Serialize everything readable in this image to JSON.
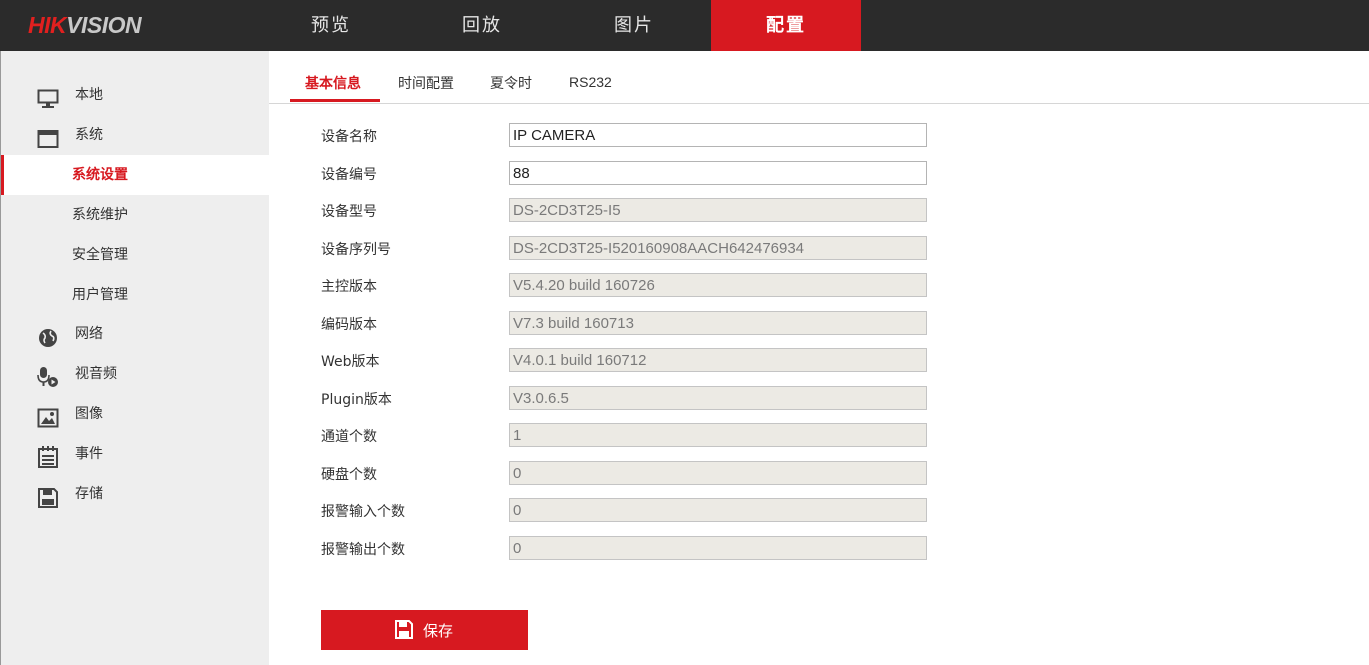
{
  "brand": {
    "logo_red": "HIK",
    "logo_gray": "VISION"
  },
  "nav": {
    "tabs": [
      "预览",
      "回放",
      "图片",
      "配置"
    ],
    "active": "配置"
  },
  "sidebar": {
    "items": [
      {
        "label": "本地",
        "icon": "monitor-icon"
      },
      {
        "label": "系统",
        "icon": "window-icon"
      },
      {
        "label": "系统设置",
        "sub": true,
        "active": true
      },
      {
        "label": "系统维护",
        "sub": true
      },
      {
        "label": "安全管理",
        "sub": true
      },
      {
        "label": "用户管理",
        "sub": true
      },
      {
        "label": "网络",
        "icon": "globe-icon"
      },
      {
        "label": "视音频",
        "icon": "microphone-icon"
      },
      {
        "label": "图像",
        "icon": "image-icon"
      },
      {
        "label": "事件",
        "icon": "list-icon"
      },
      {
        "label": "存储",
        "icon": "floppy-icon"
      }
    ]
  },
  "subtabs": [
    "基本信息",
    "时间配置",
    "夏令时",
    "RS232"
  ],
  "form": {
    "rows": [
      {
        "label": "设备名称",
        "value": "IP CAMERA",
        "editable": true
      },
      {
        "label": "设备编号",
        "value": "88",
        "editable": true
      },
      {
        "label": "设备型号",
        "value": "DS-2CD3T25-I5",
        "editable": false
      },
      {
        "label": "设备序列号",
        "value": "DS-2CD3T25-I520160908AACH642476934",
        "editable": false
      },
      {
        "label": "主控版本",
        "value": "V5.4.20 build 160726",
        "editable": false
      },
      {
        "label": "编码版本",
        "value": "V7.3 build 160713",
        "editable": false
      },
      {
        "label": "Web版本",
        "value": "V4.0.1 build 160712",
        "editable": false
      },
      {
        "label": "Plugin版本",
        "value": "V3.0.6.5",
        "editable": false
      },
      {
        "label": "通道个数",
        "value": "1",
        "editable": false
      },
      {
        "label": "硬盘个数",
        "value": "0",
        "editable": false
      },
      {
        "label": "报警输入个数",
        "value": "0",
        "editable": false
      },
      {
        "label": "报警输出个数",
        "value": "0",
        "editable": false
      }
    ],
    "save_label": "保存"
  },
  "colors": {
    "accent": "#d71920",
    "topbar": "#2b2b2b",
    "sidebar": "#eeeeee",
    "readonly_field": "#eceae4"
  }
}
